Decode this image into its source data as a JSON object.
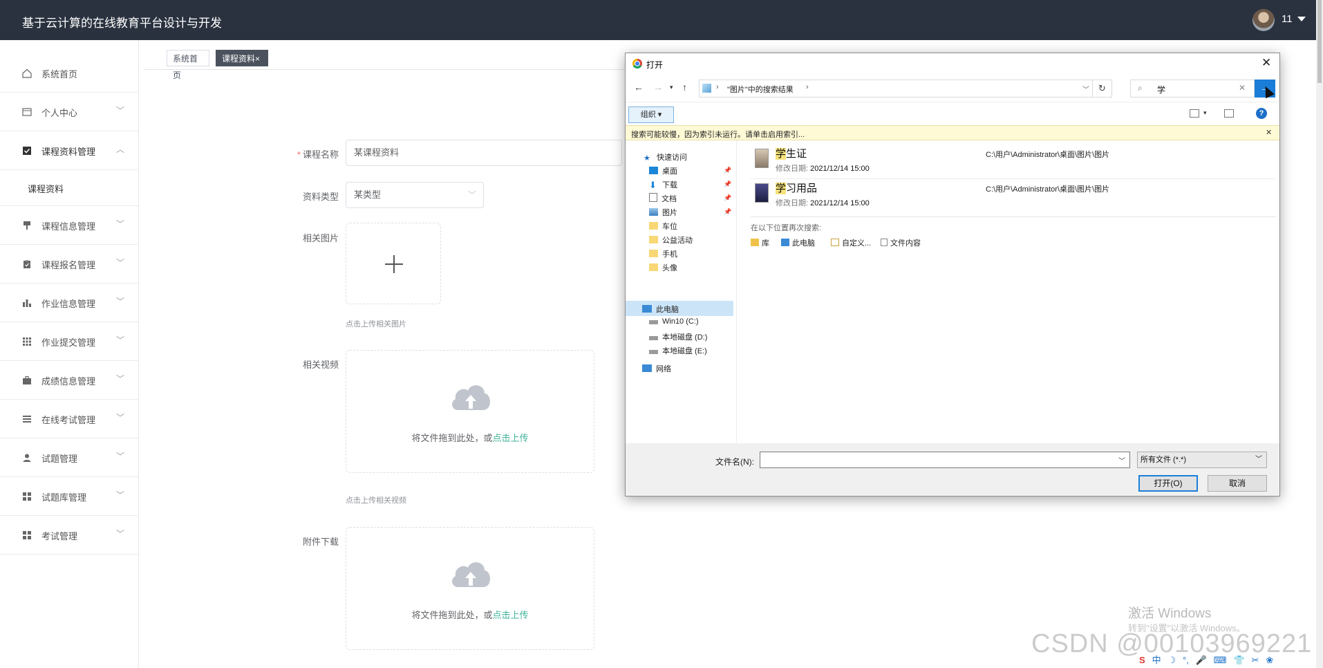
{
  "app": {
    "title": "基于云计算的在线教育平台设计与开发",
    "user_name": "11"
  },
  "sidebar": {
    "items": [
      {
        "label": "系统首页",
        "icon": "home-icon"
      },
      {
        "label": "个人中心",
        "icon": "card-icon"
      },
      {
        "label": "课程资料管理",
        "icon": "checkbox-icon",
        "expanded": true
      },
      {
        "label": "课程信息管理",
        "icon": "brush-icon"
      },
      {
        "label": "课程报名管理",
        "icon": "clipboard-icon"
      },
      {
        "label": "作业信息管理",
        "icon": "bar-chart-icon"
      },
      {
        "label": "作业提交管理",
        "icon": "grid-icon"
      },
      {
        "label": "成绩信息管理",
        "icon": "briefcase-icon"
      },
      {
        "label": "在线考试管理",
        "icon": "list-icon"
      },
      {
        "label": "试题管理",
        "icon": "user-icon"
      },
      {
        "label": "试题库管理",
        "icon": "apps-icon"
      },
      {
        "label": "考试管理",
        "icon": "apps-icon"
      }
    ],
    "subitem": "课程资料"
  },
  "tabs": {
    "home": "系统首页",
    "active": "课程资料×"
  },
  "form": {
    "name_label": "课程名称",
    "name_value": "某课程资料",
    "type_label": "资料类型",
    "type_value": "某类型",
    "image_label": "相关图片",
    "image_tip": "点击上传相关图片",
    "video_label": "相关视频",
    "video_tip": "点击上传相关视频",
    "attach_label": "附件下载",
    "drag_text": "将文件拖到此处，或",
    "drag_link": "点击上传"
  },
  "dialog": {
    "title": "打开",
    "breadcrumb": "\"图片\"中的搜索结果",
    "search_value": "学",
    "organize": "组织 ▾",
    "info": "搜索可能较慢，因为索引未运行。请单击启用索引...",
    "nav": {
      "quick_access": "快速访问",
      "items": [
        "桌面",
        "下载",
        "文档",
        "图片",
        "车位",
        "公益活动",
        "手机",
        "头像"
      ],
      "this_pc": "此电脑",
      "drives": [
        "Win10 (C:)",
        "本地磁盘 (D:)",
        "本地磁盘 (E:)"
      ],
      "network": "网络"
    },
    "results": [
      {
        "hl": "学",
        "rest": "生证",
        "date_label": "修改日期:",
        "date": "2021/12/14 15:00",
        "path": "C:\\用户\\Administrator\\桌面\\图片\\图片"
      },
      {
        "hl": "学",
        "rest": "习用品",
        "date_label": "修改日期:",
        "date": "2021/12/14 15:00",
        "path": "C:\\用户\\Administrator\\桌面\\图片\\图片"
      }
    ],
    "search_again": "在以下位置再次搜索:",
    "search_again_items": [
      "库",
      "此电脑",
      "自定义...",
      "文件内容"
    ],
    "filename_label": "文件名(N):",
    "filetype": "所有文件 (*.*)",
    "open_btn": "打开(O)",
    "cancel_btn": "取消"
  },
  "overlay": {
    "activate_title": "激活 Windows",
    "activate_sub": "转到\"设置\"以激活 Windows。",
    "watermark": "CSDN @00103969221"
  },
  "tray": [
    "S",
    "中",
    "☽",
    "°,",
    "🎤",
    "⌨",
    "👕",
    "✂",
    "❀"
  ],
  "colors": {
    "topbar": "#2a323f",
    "accent": "#3fb299",
    "win_blue": "#1a7ed8"
  }
}
